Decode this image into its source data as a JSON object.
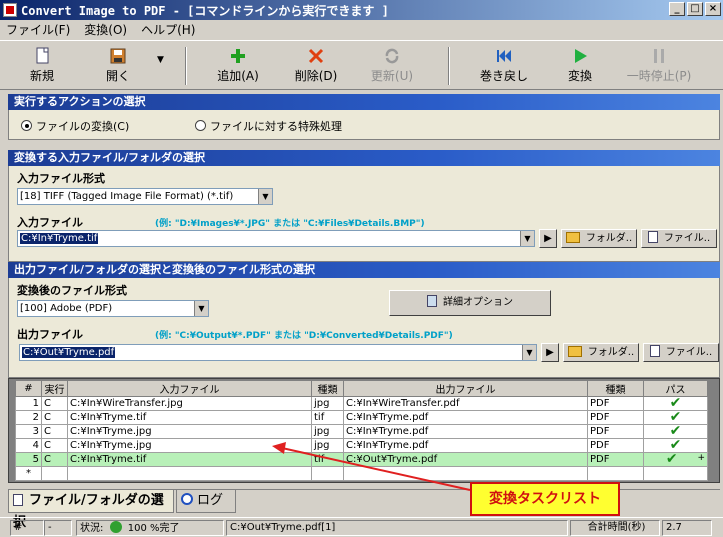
{
  "window": {
    "title": "Convert Image to PDF - [コマンドラインから実行できます ]"
  },
  "menu": [
    "ファイル(F)",
    "変換(O)",
    "ヘルプ(H)"
  ],
  "toolbar": {
    "new": "新規",
    "open": "開く",
    "add": "追加(A)",
    "delete": "削除(D)",
    "update": "更新(U)",
    "rewind": "巻き戻し",
    "convert": "変換",
    "pause": "一時停止(P)"
  },
  "action": {
    "header": "実行するアクションの選択",
    "opt_convert": "ファイルの変換(C)",
    "opt_special": "ファイルに対する特殊処理"
  },
  "input": {
    "header": "変換する入力ファイル/フォルダの選択",
    "format_label": "入力ファイル形式",
    "format_value": "[18] TIFF (Tagged Image File Format) (*.tif)",
    "file_label": "入力ファイル",
    "file_hint": "(例: \"D:¥Images¥*.JPG\" または \"C:¥Files¥Details.BMP\")",
    "file_value": "C:¥In¥Tryme.tif",
    "folder_btn": "フォルダ..",
    "file_btn": "ファイル.."
  },
  "output": {
    "header": "出力ファイル/フォルダの選択と変換後のファイル形式の選択",
    "format_label": "変換後のファイル形式",
    "format_value": "[100] Adobe (PDF)",
    "detail_btn": "詳細オプション",
    "file_label": "出力ファイル",
    "file_hint": "(例: \"C:¥Output¥*.PDF\" または \"D:¥Converted¥Details.PDF\")",
    "file_value": "C:¥Out¥Tryme.pdf",
    "folder_btn": "フォルダ..",
    "file_btn": "ファイル.."
  },
  "grid": {
    "headers": [
      "#",
      "実行",
      "入力ファイル",
      "種類",
      "出力ファイル",
      "種類",
      "パス"
    ],
    "rows": [
      [
        "1",
        "C",
        "C:¥In¥WireTransfer.jpg",
        "jpg",
        "C:¥In¥WireTransfer.pdf",
        "PDF",
        "✔"
      ],
      [
        "2",
        "C",
        "C:¥In¥Tryme.tif",
        "tif",
        "C:¥In¥Tryme.pdf",
        "PDF",
        "✔"
      ],
      [
        "3",
        "C",
        "C:¥In¥Tryme.jpg",
        "jpg",
        "C:¥In¥Tryme.pdf",
        "PDF",
        "✔"
      ],
      [
        "4",
        "C",
        "C:¥In¥Tryme.jpg",
        "jpg",
        "C:¥In¥Tryme.pdf",
        "PDF",
        "✔"
      ],
      [
        "5",
        "C",
        "C:¥In¥Tryme.tif",
        "tif",
        "C:¥Out¥Tryme.pdf",
        "PDF",
        "✔"
      ]
    ],
    "new_row_marker": "*",
    "plus": "+"
  },
  "tabs": {
    "files": "ファイル/フォルダの選択",
    "log": "ログ"
  },
  "callout": "変換タスクリスト",
  "status": {
    "hash": "#",
    "dash": "-",
    "state_label": "状況:",
    "progress": "100 %完了",
    "current": "C:¥Out¥Tryme.pdf[1]",
    "time_label": "合計時間(秒)",
    "time_value": "2.7"
  },
  "colors": {
    "title_start": "#0a246a",
    "section_header": "#1c3c94",
    "highlight_row": "#b8f0b8",
    "callout_bg": "#ffff30",
    "callout_border": "#d01010"
  }
}
